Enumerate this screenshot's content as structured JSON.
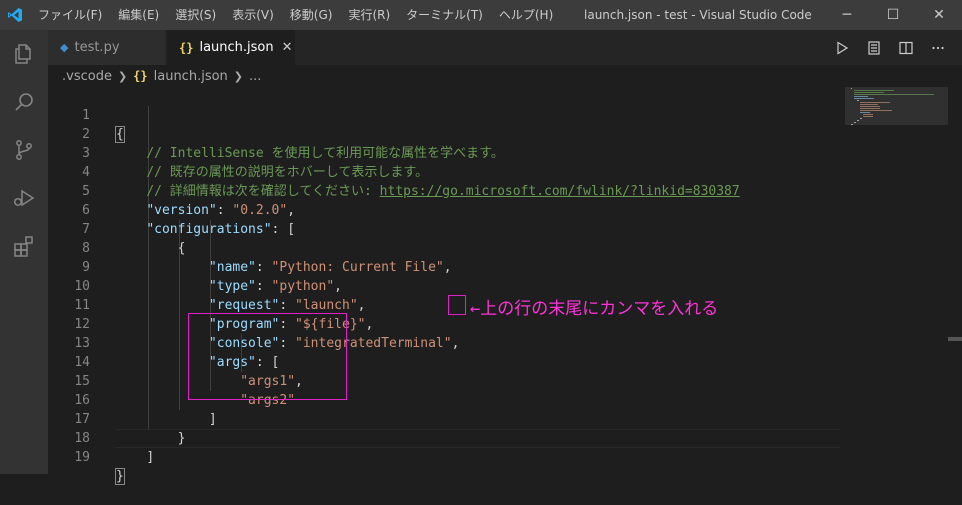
{
  "titlebar": {
    "menu": [
      "ファイル(F)",
      "編集(E)",
      "選択(S)",
      "表示(V)",
      "移動(G)",
      "実行(R)",
      "ターミナル(T)",
      "ヘルプ(H)"
    ],
    "window_title": "launch.json - test - Visual Studio Code",
    "minimize": "─",
    "maximize": "☐",
    "close": "✕"
  },
  "tabs": [
    {
      "label": "test.py",
      "icon": "python-file-icon",
      "active": false
    },
    {
      "label": "launch.json",
      "icon": "json-file-icon",
      "active": true,
      "icon_glyph": "{}",
      "close": "✕"
    }
  ],
  "breadcrumb": {
    "folder": ".vscode",
    "file_icon": "{}",
    "file": "launch.json",
    "more": "..."
  },
  "editor": {
    "line_numbers": [
      "1",
      "2",
      "3",
      "4",
      "5",
      "6",
      "7",
      "8",
      "9",
      "10",
      "11",
      "12",
      "13",
      "14",
      "15",
      "16",
      "17",
      "18",
      "19"
    ],
    "lines": {
      "l1": "{",
      "l2": "// IntelliSense を使用して利用可能な属性を学べます。",
      "l3": "// 既存の属性の説明をホバーして表示します。",
      "l4_comment": "// 詳細情報は次を確認してください: ",
      "l4_link": "https://go.microsoft.com/fwlink/?linkid=830387",
      "l5_key": "\"version\"",
      "l5_val": "\"0.2.0\"",
      "l6_key": "\"configurations\"",
      "l6_rest": ": [",
      "l7": "{",
      "l8_key": "\"name\"",
      "l8_val": "\"Python: Current File\"",
      "l9_key": "\"type\"",
      "l9_val": "\"python\"",
      "l10_key": "\"request\"",
      "l10_val": "\"launch\"",
      "l11_key": "\"program\"",
      "l11_val": "\"${file}\"",
      "l12_key": "\"console\"",
      "l12_val": "\"integratedTerminal\"",
      "l12_comma": ",",
      "l13_key": "\"args\"",
      "l13_rest": ": [",
      "l14": "\"args1\"",
      "l15": "\"args2\"",
      "l16": "]",
      "l17": "}",
      "l18": "]",
      "l19": "}"
    }
  },
  "annotation": {
    "text": "←上の行の末尾にカンマを入れる",
    "color": "#ff33d9"
  },
  "colors": {
    "accent": "#007acc",
    "comment": "#6a9955",
    "key": "#9cdcfe",
    "string": "#ce9178",
    "annotation_box": "#e020c8"
  }
}
